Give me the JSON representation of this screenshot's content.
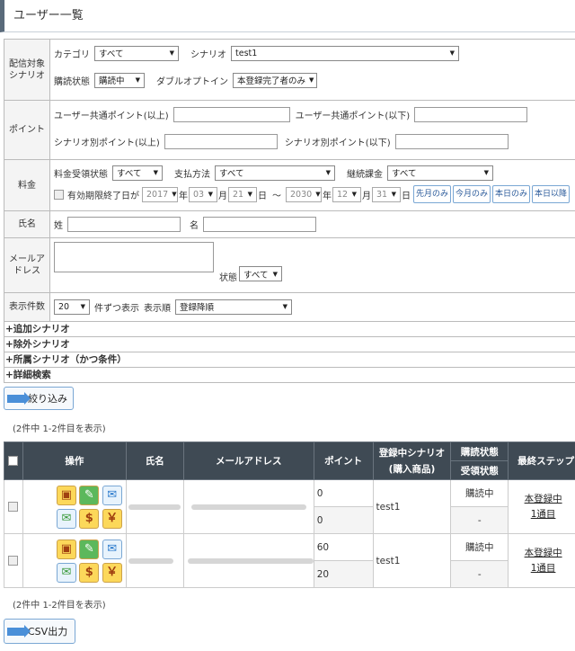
{
  "page": {
    "title": "ユーザー一覧"
  },
  "form": {
    "delivery": {
      "label": "配信対象シナリオ",
      "category_label": "カテゴリ",
      "category_value": "すべて",
      "scenario_label": "シナリオ",
      "scenario_value": "test1",
      "status_label": "購読状態",
      "status_value": "購読中",
      "double_optin_label": "ダブルオプトイン",
      "double_optin_value": "本登録完了者のみ"
    },
    "points": {
      "label": "ポイント",
      "common_min": "ユーザー共通ポイント(以上)",
      "common_max": "ユーザー共通ポイント(以下)",
      "scenario_min": "シナリオ別ポイント(以上)",
      "scenario_max": "シナリオ別ポイント(以下)"
    },
    "fee": {
      "label": "料金",
      "receive_label": "料金受領状態",
      "receive_value": "すべて",
      "payment_label": "支払方法",
      "payment_value": "すべて",
      "recurring_label": "継続課金",
      "recurring_value": "すべて",
      "expiry_label": "有効期限終了日が",
      "from_year": "2017",
      "from_month": "03",
      "from_day": "21",
      "to_year": "2030",
      "to_month": "12",
      "to_day": "31",
      "year_unit": "年",
      "month_unit": "月",
      "day_unit": "日",
      "tilde": "～",
      "btn_prev_month": "先月のみ",
      "btn_this_month": "今月のみ",
      "btn_today": "本日のみ",
      "btn_after_today": "本日以降"
    },
    "name": {
      "label": "氏名",
      "last_label": "姓",
      "first_label": "名"
    },
    "email": {
      "label": "メールアドレス",
      "state_label": "状態",
      "state_value": "すべて"
    },
    "display": {
      "label": "表示件数",
      "count_value": "20",
      "count_suffix": "件ずつ表示",
      "order_label": "表示順",
      "order_value": "登録降順"
    },
    "accordions": [
      "+追加シナリオ",
      "+除外シナリオ",
      "+所属シナリオ（かつ条件）",
      "+詳細検索"
    ],
    "filter_button": "絞り込み"
  },
  "result_count_top": "(2件中 1-2件目を表示)",
  "result_count_bottom": "(2件中 1-2件目を表示)",
  "table": {
    "headers": {
      "ops": "操作",
      "name": "氏名",
      "email": "メールアドレス",
      "points": "ポイント",
      "scenario": "登録中シナリオ",
      "scenario_sub": "(購入商品)",
      "sub_status": "購読状態",
      "recv_status": "受領状態",
      "last_step": "最終ステップ"
    },
    "rows": [
      {
        "points_top": "0",
        "points_bottom": "0",
        "scenario": "test1",
        "sub_status": "購読中",
        "recv_status": "-",
        "last_step_1": "本登録中",
        "last_step_2": "1通目"
      },
      {
        "points_top": "60",
        "points_bottom": "20",
        "scenario": "test1",
        "sub_status": "購読中",
        "recv_status": "-",
        "last_step_1": "本登録中",
        "last_step_2": "1通目"
      }
    ]
  },
  "csv_button": "CSV出力",
  "icons": {
    "card": "card-icon",
    "edit": "pencil-icon",
    "mail": "mail-icon",
    "dollar": "$",
    "yen": "￥"
  }
}
